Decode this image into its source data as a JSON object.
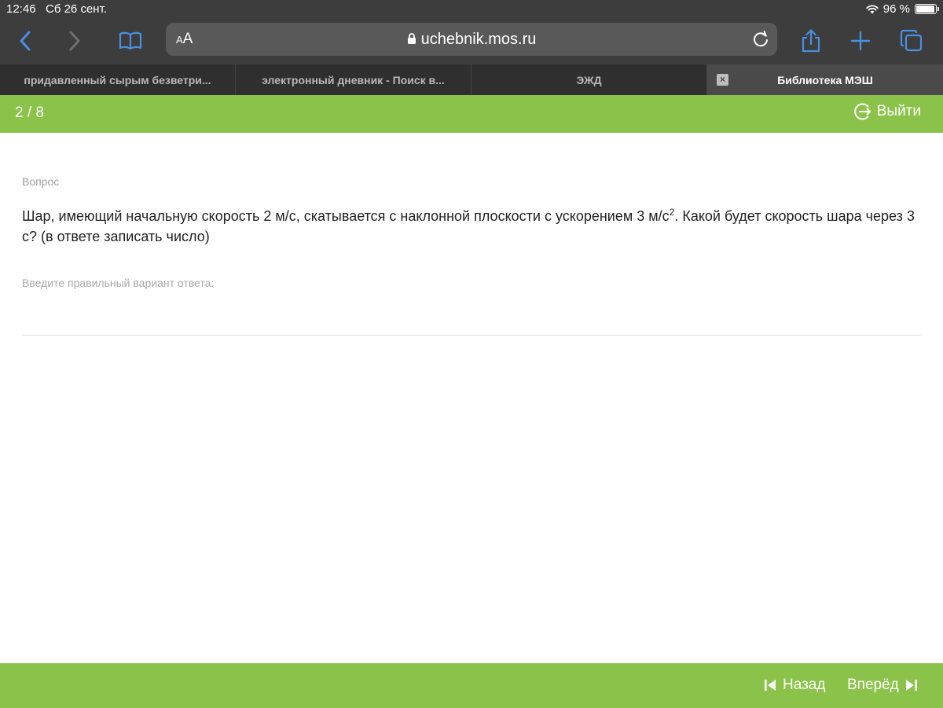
{
  "status": {
    "time": "12:46",
    "date": "Сб 26 сент.",
    "battery": "96 %",
    "battery_level": 0.96
  },
  "browser": {
    "text_size": "AA",
    "url": "uchebnik.mos.ru",
    "tabs": [
      {
        "label": "придавленный сырым безветри..."
      },
      {
        "label": "электронный дневник - Поиск в..."
      },
      {
        "label": "ЭЖД"
      },
      {
        "label": "Библиотека МЭШ"
      }
    ]
  },
  "header": {
    "counter": "2 / 8",
    "exit_label": "Выйти"
  },
  "question": {
    "label": "Вопрос",
    "text_part1": "Шар, имеющий начальную скорость 2 м/с, скатывается с наклонной плоскости с ускорением 3 м/с",
    "sup": "2",
    "text_part2": ".  Какой будет скорость шара через 3 с? (в ответе записать число)"
  },
  "answer": {
    "label": "Введите правильный вариант ответа:",
    "value": ""
  },
  "footer": {
    "back_label": "Назад",
    "forward_label": "Вперёд"
  },
  "colors": {
    "accent": "#8bc34a",
    "ios_blue": "#4a90e2",
    "chrome_dark": "#3d3d3d"
  }
}
